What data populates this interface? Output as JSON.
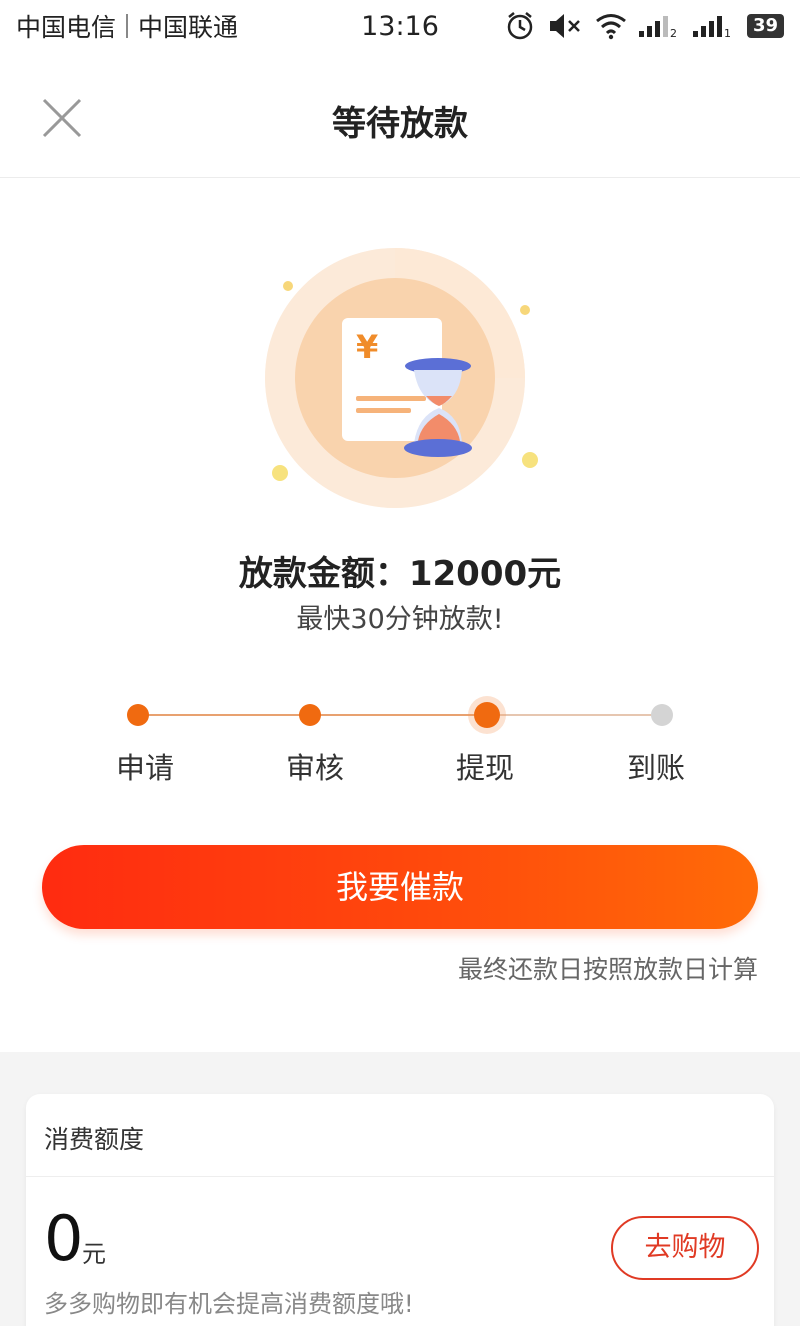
{
  "status_bar": {
    "carrier_1": "中国电信",
    "carrier_2": "中国联通",
    "time": "13:16",
    "battery": "39",
    "icons": [
      "alarm-icon",
      "mute-icon",
      "wifi-icon",
      "signal-icon",
      "signal-icon",
      "battery-icon"
    ]
  },
  "header": {
    "title": "等待放款",
    "close_icon": "close-icon"
  },
  "illustration": {
    "currency_symbol": "¥",
    "icon": "hourglass-icon"
  },
  "loan": {
    "amount_title": "放款金额：12000元",
    "subtitle": "最快30分钟放款!"
  },
  "progress": {
    "current_step": 2,
    "steps": [
      {
        "label": "申请",
        "state": "done"
      },
      {
        "label": "审核",
        "state": "done"
      },
      {
        "label": "提现",
        "state": "current"
      },
      {
        "label": "到账",
        "state": "todo"
      }
    ]
  },
  "actions": {
    "urge_label": "我要催款",
    "repay_note": "最终还款日按照放款日计算"
  },
  "credit": {
    "header": "消费额度",
    "amount": "0",
    "unit": "元",
    "shop_label": "去购物",
    "tip": "多多购物即有机会提高消费额度哦!"
  },
  "colors": {
    "accent": "#f06a10",
    "button_start": "#ff2b10",
    "button_end": "#ff6b08",
    "shop_red": "#e03a24",
    "pending_gray": "#d4d4d4"
  }
}
